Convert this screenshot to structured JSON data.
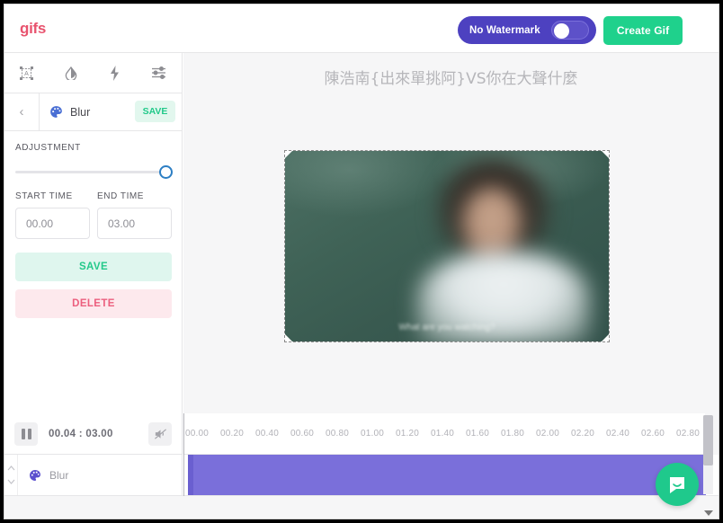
{
  "header": {
    "logo": "gifs",
    "watermark_label": "No Watermark",
    "watermark_on": false,
    "create_gif_label": "Create Gif",
    "accent_purple": "#4d41c0",
    "accent_green": "#1fd18c",
    "logo_color": "#e8536e"
  },
  "toolbar": {
    "tools": [
      {
        "name": "text-tool",
        "icon": "text-box-icon"
      },
      {
        "name": "blur-tool",
        "icon": "droplet-icon"
      },
      {
        "name": "flash-tool",
        "icon": "lightning-icon"
      },
      {
        "name": "adjust-tool",
        "icon": "sliders-icon"
      }
    ]
  },
  "effect_panel": {
    "back_icon": "chevron-left-icon",
    "effect_icon": "palette-icon",
    "effect_name": "Blur",
    "save_chip_label": "SAVE",
    "adjustment_label": "ADJUSTMENT",
    "adjustment_value": 100,
    "start_time_label": "START TIME",
    "end_time_label": "END TIME",
    "start_time_value": "00.00",
    "end_time_value": "03.00",
    "save_label": "SAVE",
    "delete_label": "DELETE"
  },
  "preview": {
    "video_title": "陳浩南{出來單挑阿}VS你在大聲什麼",
    "caption": "What are you watching?"
  },
  "timeline": {
    "pause_icon": "pause-icon",
    "time_readout": "00.04 : 03.00",
    "mute_icon": "speaker-muted-icon",
    "ticks": [
      "00.00",
      "00.20",
      "00.40",
      "00.60",
      "00.80",
      "01.00",
      "01.20",
      "01.40",
      "01.60",
      "01.80",
      "02.00",
      "02.20",
      "02.40",
      "02.60",
      "02.80"
    ],
    "track": {
      "icon": "palette-icon",
      "label": "Blur",
      "clip_color": "#7a6fda"
    },
    "scroll_up_icon": "chevron-up-icon",
    "scroll_down_icon": "chevron-down-icon"
  },
  "chat": {
    "icon": "chat-bubble-icon",
    "color": "#1fc98c"
  }
}
